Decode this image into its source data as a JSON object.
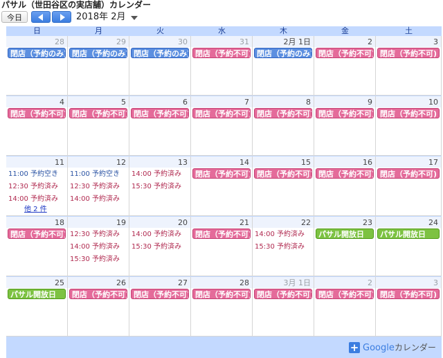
{
  "title": "パサル（世田谷区の実店舗）カレンダー",
  "toolbar": {
    "today": "今日",
    "month": "2018年 2月"
  },
  "weekdays": [
    "日",
    "月",
    "火",
    "水",
    "木",
    "金",
    "土"
  ],
  "weeks": [
    {
      "days": [
        {
          "num": "28",
          "muted": true,
          "events": [
            {
              "label": "閉店（予約のみ)",
              "color": "blue"
            }
          ]
        },
        {
          "num": "29",
          "muted": true,
          "events": [
            {
              "label": "閉店（予約のみ)",
              "color": "blue"
            }
          ]
        },
        {
          "num": "30",
          "muted": true,
          "events": [
            {
              "label": "閉店（予約のみ)",
              "color": "blue"
            }
          ]
        },
        {
          "num": "31",
          "muted": true,
          "events": [
            {
              "label": "閉店（予約不可)",
              "color": "pink"
            }
          ]
        },
        {
          "num": "2月 1日",
          "muted": false,
          "events": [
            {
              "label": "閉店（予約のみ)",
              "color": "blue"
            }
          ]
        },
        {
          "num": "2",
          "muted": false,
          "events": [
            {
              "label": "閉店（予約不可)",
              "color": "pink"
            }
          ]
        },
        {
          "num": "3",
          "muted": false,
          "events": [
            {
              "label": "閉店（予約不可)",
              "color": "pink"
            }
          ]
        }
      ]
    },
    {
      "days": [
        {
          "num": "4",
          "events": [
            {
              "label": "閉店（予約不可)",
              "color": "pink"
            }
          ]
        },
        {
          "num": "5",
          "events": [
            {
              "label": "閉店（予約不可)",
              "color": "pink"
            }
          ]
        },
        {
          "num": "6",
          "events": [
            {
              "label": "閉店（予約不可)",
              "color": "pink"
            }
          ]
        },
        {
          "num": "7",
          "events": [
            {
              "label": "閉店（予約不可)",
              "color": "pink"
            }
          ]
        },
        {
          "num": "8",
          "events": [
            {
              "label": "閉店（予約不可)",
              "color": "pink"
            }
          ]
        },
        {
          "num": "9",
          "events": [
            {
              "label": "閉店（予約不可)",
              "color": "pink"
            }
          ]
        },
        {
          "num": "10",
          "events": [
            {
              "label": "閉店（予約不可)",
              "color": "pink"
            }
          ]
        }
      ]
    },
    {
      "days": [
        {
          "num": "11",
          "timed": [
            {
              "time": "11:00",
              "text": "予約空き",
              "kind": "avail"
            },
            {
              "time": "12:30",
              "text": "予約済み",
              "kind": "booked"
            },
            {
              "time": "14:00",
              "text": "予約済み",
              "kind": "booked"
            }
          ],
          "more": "他 2 件"
        },
        {
          "num": "12",
          "timed": [
            {
              "time": "11:00",
              "text": "予約空き",
              "kind": "avail"
            },
            {
              "time": "12:30",
              "text": "予約済み",
              "kind": "booked"
            },
            {
              "time": "14:00",
              "text": "予約済み",
              "kind": "booked"
            }
          ]
        },
        {
          "num": "13",
          "timed": [
            {
              "time": "14:00",
              "text": "予約済み",
              "kind": "booked"
            },
            {
              "time": "15:30",
              "text": "予約済み",
              "kind": "booked"
            }
          ]
        },
        {
          "num": "14",
          "events": [
            {
              "label": "閉店（予約不可)",
              "color": "pink"
            }
          ]
        },
        {
          "num": "15",
          "events": [
            {
              "label": "閉店（予約不可)",
              "color": "pink"
            }
          ]
        },
        {
          "num": "16",
          "events": [
            {
              "label": "閉店（予約不可)",
              "color": "pink"
            }
          ]
        },
        {
          "num": "17",
          "events": [
            {
              "label": "閉店（予約不可)",
              "color": "pink"
            }
          ]
        }
      ]
    },
    {
      "days": [
        {
          "num": "18",
          "events": [
            {
              "label": "閉店（予約不可)",
              "color": "pink"
            }
          ]
        },
        {
          "num": "19",
          "timed": [
            {
              "time": "12:30",
              "text": "予約済み",
              "kind": "booked"
            },
            {
              "time": "14:00",
              "text": "予約済み",
              "kind": "booked"
            },
            {
              "time": "15:30",
              "text": "予約済み",
              "kind": "booked"
            }
          ]
        },
        {
          "num": "20",
          "timed": [
            {
              "time": "14:00",
              "text": "予約済み",
              "kind": "booked"
            },
            {
              "time": "15:30",
              "text": "予約済み",
              "kind": "booked"
            }
          ]
        },
        {
          "num": "21",
          "events": [
            {
              "label": "閉店（予約不可)",
              "color": "pink"
            }
          ]
        },
        {
          "num": "22",
          "timed": [
            {
              "time": "14:00",
              "text": "予約済み",
              "kind": "booked"
            },
            {
              "time": "15:30",
              "text": "予約済み",
              "kind": "booked"
            }
          ]
        },
        {
          "num": "23",
          "events": [
            {
              "label": "パサル開放日",
              "color": "green"
            }
          ]
        },
        {
          "num": "24",
          "events": [
            {
              "label": "パサル開放日",
              "color": "green"
            }
          ]
        }
      ]
    },
    {
      "days": [
        {
          "num": "25",
          "events": [
            {
              "label": "パサル開放日",
              "color": "green"
            }
          ]
        },
        {
          "num": "26",
          "events": [
            {
              "label": "閉店（予約不可)",
              "color": "pink"
            }
          ]
        },
        {
          "num": "27",
          "events": [
            {
              "label": "閉店（予約不可)",
              "color": "pink"
            }
          ]
        },
        {
          "num": "28",
          "events": [
            {
              "label": "閉店（予約不可)",
              "color": "pink"
            }
          ]
        },
        {
          "num": "3月 1日",
          "muted": true,
          "events": [
            {
              "label": "閉店（予約不可)",
              "color": "pink"
            }
          ]
        },
        {
          "num": "2",
          "muted": true,
          "events": [
            {
              "label": "閉店（予約不可)",
              "color": "pink"
            }
          ]
        },
        {
          "num": "3",
          "muted": true,
          "events": [
            {
              "label": "閉店（予約不可)",
              "color": "pink"
            }
          ]
        }
      ]
    }
  ],
  "footer": {
    "brand": "Google",
    "product": "カレンダー"
  }
}
